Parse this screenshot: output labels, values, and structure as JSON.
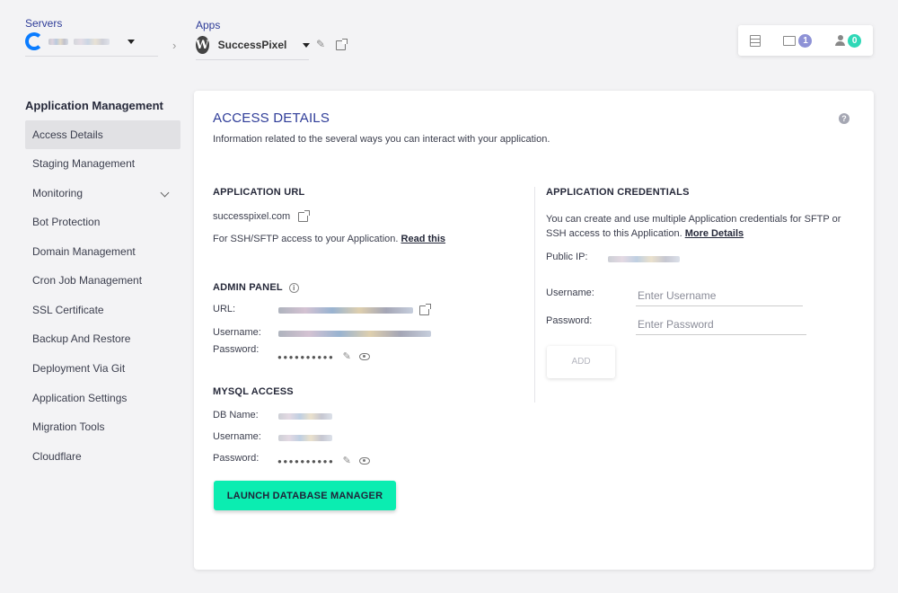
{
  "topbar": {
    "servers_label": "Servers",
    "apps_label": "Apps",
    "app_name": "SuccessPixel",
    "folder_count": "1",
    "members_count": "0"
  },
  "sidebar": {
    "title": "Application Management",
    "items": [
      {
        "label": "Access Details"
      },
      {
        "label": "Staging Management"
      },
      {
        "label": "Monitoring"
      },
      {
        "label": "Bot Protection"
      },
      {
        "label": "Domain Management"
      },
      {
        "label": "Cron Job Management"
      },
      {
        "label": "SSL Certificate"
      },
      {
        "label": "Backup And Restore"
      },
      {
        "label": "Deployment Via Git"
      },
      {
        "label": "Application Settings"
      },
      {
        "label": "Migration Tools"
      },
      {
        "label": "Cloudflare"
      }
    ]
  },
  "main": {
    "title": "ACCESS DETAILS",
    "description": "Information related to the several ways you can interact with your application.",
    "help": "?",
    "app_url": {
      "heading": "APPLICATION URL",
      "url": "successpixel.com",
      "ssh_text": "For SSH/SFTP access to your Application.",
      "ssh_link": "Read this"
    },
    "admin_panel": {
      "heading": "ADMIN PANEL",
      "url_label": "URL:",
      "username_label": "Username:",
      "password_label": "Password:",
      "password_mask": "●●●●●●●●●●"
    },
    "mysql": {
      "heading": "MYSQL ACCESS",
      "db_label": "DB Name:",
      "username_label": "Username:",
      "password_label": "Password:",
      "password_mask": "●●●●●●●●●●",
      "launch_label": "LAUNCH DATABASE MANAGER"
    },
    "credentials": {
      "heading": "APPLICATION CREDENTIALS",
      "text": "You can create and use multiple Application credentials for SFTP or SSH access to this Application.",
      "more_link": "More Details",
      "ip_label": "Public IP:",
      "username_label": "Username:",
      "username_placeholder": "Enter Username",
      "password_label": "Password:",
      "password_placeholder": "Enter Password",
      "add_label": "ADD"
    }
  },
  "colors": {
    "accent": "#2e3c98",
    "launch": "#0bedb1",
    "badge_folder": "#8e92d6",
    "badge_members": "#2fd8b7"
  }
}
